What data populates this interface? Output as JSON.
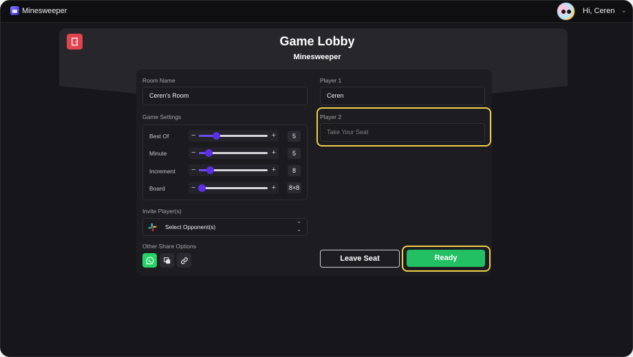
{
  "app": {
    "name": "Minesweeper"
  },
  "user": {
    "greeting": "Hi, Ceren"
  },
  "lobby": {
    "title": "Game Lobby",
    "subtitle": "Minesweeper"
  },
  "room": {
    "label": "Room Name",
    "value": "Ceren's Room"
  },
  "settings": {
    "label": "Game Settings",
    "items": [
      {
        "label": "Best Of",
        "value": "5",
        "level": 0.25
      },
      {
        "label": "Minute",
        "value": "5",
        "level": 0.14
      },
      {
        "label": "Increment",
        "value": "8",
        "level": 0.16
      },
      {
        "label": "Board",
        "value": "8×8",
        "level": 0.04
      }
    ]
  },
  "invite": {
    "label": "Invite Player(s)",
    "select_value": "Select Opponent(s)"
  },
  "share": {
    "label": "Other Share Options",
    "icons": [
      "whatsapp-icon",
      "copy-icon",
      "link-icon"
    ]
  },
  "players": {
    "player1": {
      "label": "Player 1",
      "value": "Ceren"
    },
    "player2": {
      "label": "Player 2",
      "placeholder": "Take Your Seat"
    }
  },
  "actions": {
    "leave": "Leave Seat",
    "ready": "Ready"
  },
  "colors": {
    "accent": "#5b2ee8",
    "ready": "#22c063",
    "highlight": "#f2d04a",
    "exit": "#e0454f",
    "whatsapp": "#25d366"
  }
}
